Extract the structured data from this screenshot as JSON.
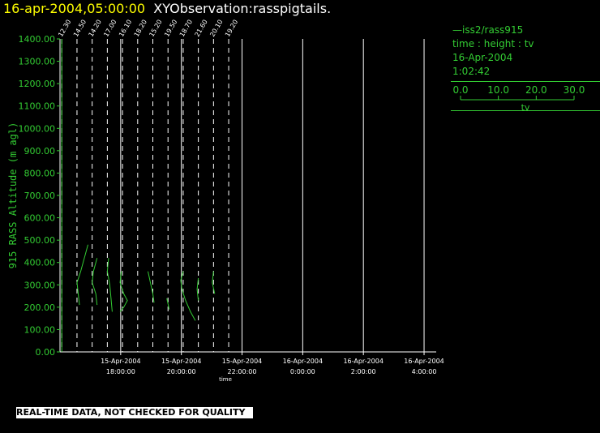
{
  "title": {
    "date_text": "16-apr-2004,05:00:00",
    "observation_text": "XYObservation:rasspigtails."
  },
  "legend": {
    "series_label": "iss2/rass915",
    "axes_text": "time : height : tv",
    "date": "16-Apr-2004",
    "time": "1:02:42",
    "scale_ticks": [
      "0.0",
      "10.0",
      "20.0",
      "30.0"
    ],
    "scale_label": "tv"
  },
  "footer": "REAL-TIME DATA, NOT CHECKED FOR QUALITY",
  "colors": {
    "title_date": "#ffff00",
    "title_text": "#ffffff",
    "data": "#33cc33",
    "axes": "#ffffff",
    "background": "#000000"
  },
  "chart_data": {
    "type": "line",
    "ylabel": "915 RASS Altitude (m agl)",
    "xlabel": "time",
    "ylim": [
      0,
      1400
    ],
    "yticks": [
      "0.00",
      "100.00",
      "200.00",
      "300.00",
      "400.00",
      "500.00",
      "600.00",
      "700.00",
      "800.00",
      "900.00",
      "1000.00",
      "1100.00",
      "1200.00",
      "1300.00",
      "1400.00"
    ],
    "xlim_hours": [
      16.0,
      22.2
    ],
    "xticks": [
      {
        "date": "15-Apr-2004",
        "time": "18:00:00",
        "h": 17.0
      },
      {
        "date": "15-Apr-2004",
        "time": "20:00:00",
        "h": 18.0
      },
      {
        "date": "15-Apr-2004",
        "time": "22:00:00",
        "h": 19.0
      },
      {
        "date": "16-Apr-2004",
        "time": "0:00:00",
        "h": 20.0
      },
      {
        "date": "16-Apr-2004",
        "time": "2:00:00",
        "h": 21.0
      },
      {
        "date": "16-Apr-2004",
        "time": "4:00:00",
        "h": 22.0
      }
    ],
    "profiles": [
      {
        "label": "12.30",
        "h": 16.03,
        "points": [
          [
            0.0,
            1400
          ],
          [
            0.0,
            0
          ]
        ]
      },
      {
        "label": "14.50",
        "h": 16.28,
        "points": [
          [
            0.18,
            480
          ],
          [
            0.12,
            420
          ],
          [
            0.06,
            360
          ],
          [
            0.0,
            310
          ],
          [
            0.02,
            260
          ],
          [
            0.04,
            210
          ]
        ]
      },
      {
        "label": "14.20",
        "h": 16.53,
        "points": [
          [
            0.08,
            420
          ],
          [
            0.02,
            360
          ],
          [
            0.0,
            310
          ],
          [
            0.06,
            260
          ],
          [
            0.08,
            210
          ]
        ]
      },
      {
        "label": "17.00",
        "h": 16.78,
        "points": [
          [
            0.02,
            420
          ],
          [
            0.0,
            360
          ],
          [
            0.04,
            300
          ],
          [
            0.06,
            240
          ],
          [
            0.08,
            180
          ]
        ]
      },
      {
        "label": "16.10",
        "h": 17.03,
        "points": [
          [
            -0.02,
            360
          ],
          [
            -0.04,
            310
          ],
          [
            0.02,
            260
          ],
          [
            0.08,
            230
          ],
          [
            0.02,
            200
          ],
          [
            -0.04,
            180
          ]
        ]
      },
      {
        "label": "18.20",
        "h": 17.28,
        "points": []
      },
      {
        "label": "15.20",
        "h": 17.53,
        "points": [
          [
            -0.08,
            360
          ],
          [
            -0.04,
            310
          ],
          [
            0.0,
            260
          ],
          [
            0.02,
            220
          ]
        ]
      },
      {
        "label": "19.50",
        "h": 17.78,
        "points": [
          [
            -0.02,
            240
          ],
          [
            0.02,
            190
          ]
        ]
      },
      {
        "label": "18.70",
        "h": 18.03,
        "points": [
          [
            0.0,
            360
          ],
          [
            -0.04,
            320
          ],
          [
            -0.02,
            280
          ],
          [
            0.04,
            230
          ],
          [
            0.12,
            180
          ],
          [
            0.2,
            140
          ]
        ]
      },
      {
        "label": "21.60",
        "h": 18.28,
        "points": [
          [
            0.0,
            330
          ],
          [
            -0.02,
            280
          ],
          [
            0.0,
            230
          ]
        ]
      },
      {
        "label": "20.10",
        "h": 18.53,
        "points": [
          [
            0.0,
            360
          ],
          [
            -0.02,
            310
          ],
          [
            0.02,
            260
          ]
        ]
      },
      {
        "label": "19.20",
        "h": 18.78,
        "points": []
      }
    ]
  }
}
